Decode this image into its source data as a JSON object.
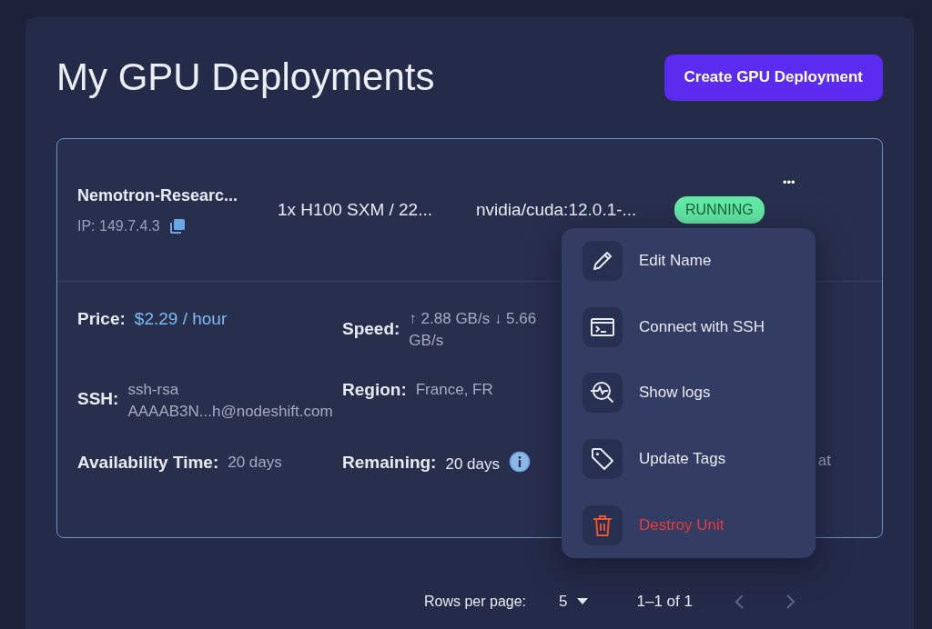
{
  "page": {
    "title": "My GPU Deployments",
    "create_button": "Create GPU Deployment"
  },
  "deployment": {
    "name": "Nemotron-Researc...",
    "ip": "IP: 149.7.4.3",
    "gpu": "1x H100 SXM / 22...",
    "image": "nvidia/cuda:12.0.1-...",
    "status": "RUNNING",
    "more": "•••",
    "details": [
      {
        "label": "Price:",
        "value": "$2.29 / hour",
        "kind": "price"
      },
      {
        "label": "Speed:",
        "value": "↑ 2.88 GB/s ↓ 5.66 GB/s",
        "kind": "plain"
      },
      {
        "label": "SSH:",
        "value": "ssh-rsa AAAAB3N...h@nodeshift.com",
        "kind": "plain"
      },
      {
        "label": "Region:",
        "value": "France, FR",
        "kind": "plain"
      },
      {
        "label": "Availability Time:",
        "value": "20 days",
        "kind": "plain"
      },
      {
        "label": "Remaining:",
        "value": "20 days",
        "kind": "info"
      }
    ],
    "column_3_fragment": "at"
  },
  "menu": [
    {
      "label": "Edit Name",
      "kind": "edit",
      "danger": false
    },
    {
      "label": "Connect with SSH",
      "kind": "terminal",
      "danger": false
    },
    {
      "label": "Show logs",
      "kind": "logs",
      "danger": false
    },
    {
      "label": "Update Tags",
      "kind": "tag",
      "danger": false
    },
    {
      "label": "Destroy Unit",
      "kind": "trash",
      "danger": true
    }
  ],
  "pagination": {
    "rows_label": "Rows per page:",
    "rows_value": "5",
    "range": "1–1 of 1"
  }
}
